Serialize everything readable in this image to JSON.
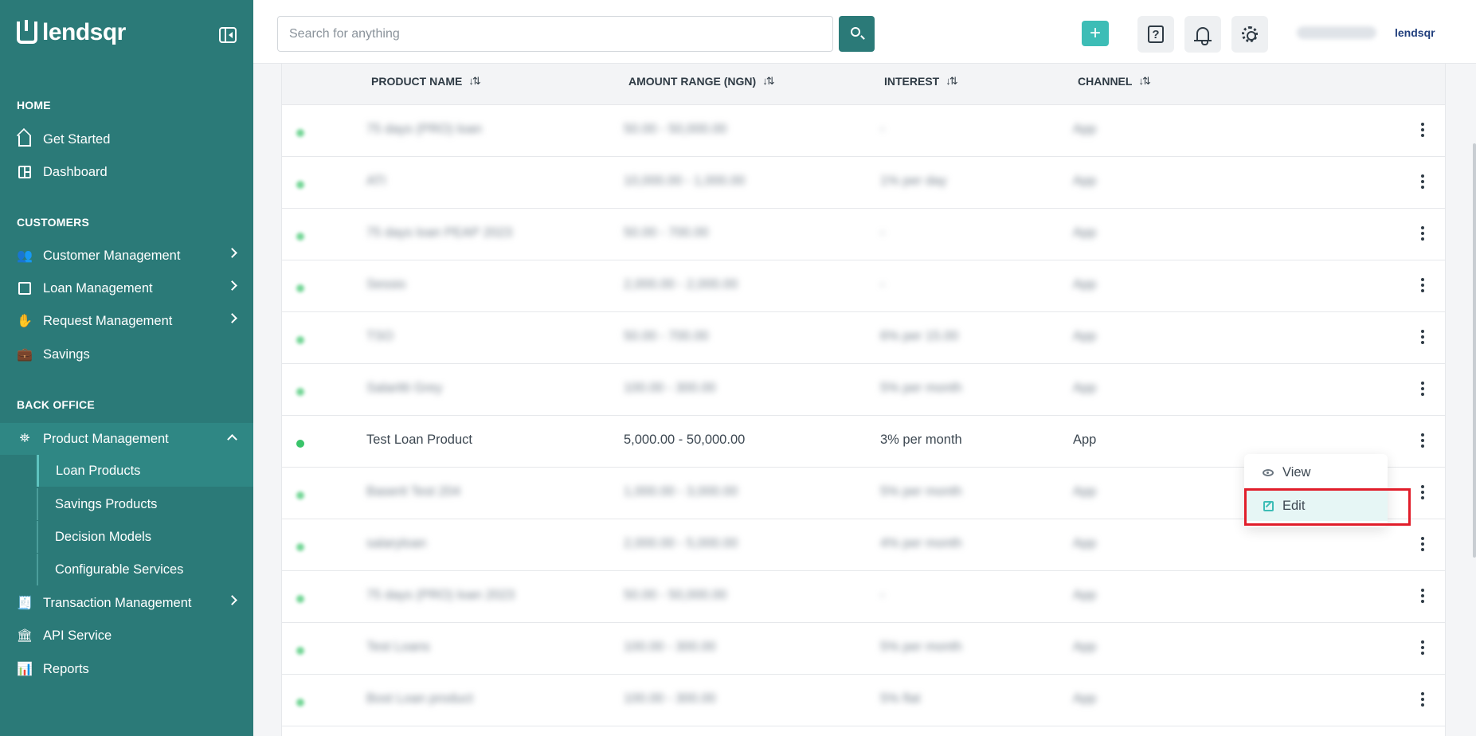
{
  "brand": {
    "name": "lendsqr"
  },
  "sidebar": {
    "sections": {
      "home": "HOME",
      "customers": "CUSTOMERS",
      "back_office": "BACK OFFICE"
    },
    "items": {
      "get_started": "Get Started",
      "dashboard": "Dashboard",
      "customer_management": "Customer Management",
      "loan_management": "Loan Management",
      "request_management": "Request Management",
      "savings": "Savings",
      "product_management": "Product Management",
      "transaction_management": "Transaction Management",
      "api_service": "API Service",
      "reports": "Reports"
    },
    "sub_items": {
      "loan_products": "Loan Products",
      "savings_products": "Savings Products",
      "decision_models": "Decision Models",
      "configurable_services": "Configurable Services"
    }
  },
  "topbar": {
    "search_placeholder": "Search for anything",
    "plus_label": "+",
    "help_label": "?",
    "brand_small": "lendsqr"
  },
  "table": {
    "headers": {
      "product_name": "PRODUCT NAME",
      "amount_range": "AMOUNT RANGE (NGN)",
      "interest": "INTEREST",
      "channel": "CHANNEL"
    },
    "sort_icon": "↓⇅",
    "rows": [
      {
        "name": "75 days (PRO) loan",
        "amount": "50.00 - 50,000.00",
        "interest": "-",
        "channel": "App",
        "blurred": true
      },
      {
        "name": "ATI",
        "amount": "10,000.00 - 1,000.00",
        "interest": "1% per day",
        "channel": "App",
        "blurred": true
      },
      {
        "name": "75 days loan PEAP 2023",
        "amount": "50.00 - 700.00",
        "interest": "-",
        "channel": "App",
        "blurred": true
      },
      {
        "name": "Sessio",
        "amount": "2,000.00 - 2,000.00",
        "interest": "-",
        "channel": "App",
        "blurred": true
      },
      {
        "name": "TSO",
        "amount": "50.00 - 700.00",
        "interest": "6% per 15.00",
        "channel": "App",
        "blurred": true
      },
      {
        "name": "Salaritti Grey",
        "amount": "100.00 - 300.00",
        "interest": "5% per month",
        "channel": "App",
        "blurred": true
      },
      {
        "name": "Test Loan Product",
        "amount": "5,000.00 - 50,000.00",
        "interest": "3% per month",
        "channel": "App",
        "blurred": false
      },
      {
        "name": "Baserit Test 204",
        "amount": "1,000.00 - 3,000.00",
        "interest": "5% per month",
        "channel": "App",
        "blurred": true
      },
      {
        "name": "salaryloan",
        "amount": "2,000.00 - 5,000.00",
        "interest": "4% per month",
        "channel": "App",
        "blurred": true
      },
      {
        "name": "75 days (PRO) loan 2023",
        "amount": "50.00 - 50,000.00",
        "interest": "-",
        "channel": "App",
        "blurred": true
      },
      {
        "name": "Test Loans",
        "amount": "100.00 - 300.00",
        "interest": "5% per month",
        "channel": "App",
        "blurred": true
      },
      {
        "name": "Bost Loan product",
        "amount": "100.00 - 300.00",
        "interest": "5% flat",
        "channel": "App",
        "blurred": true
      }
    ]
  },
  "context_menu": {
    "view": "View",
    "edit": "Edit"
  },
  "colors": {
    "sidebar_bg": "#2b7a78",
    "accent": "#3dbdb6",
    "status_active": "#39c46a",
    "highlight_border": "#e11d2a"
  }
}
